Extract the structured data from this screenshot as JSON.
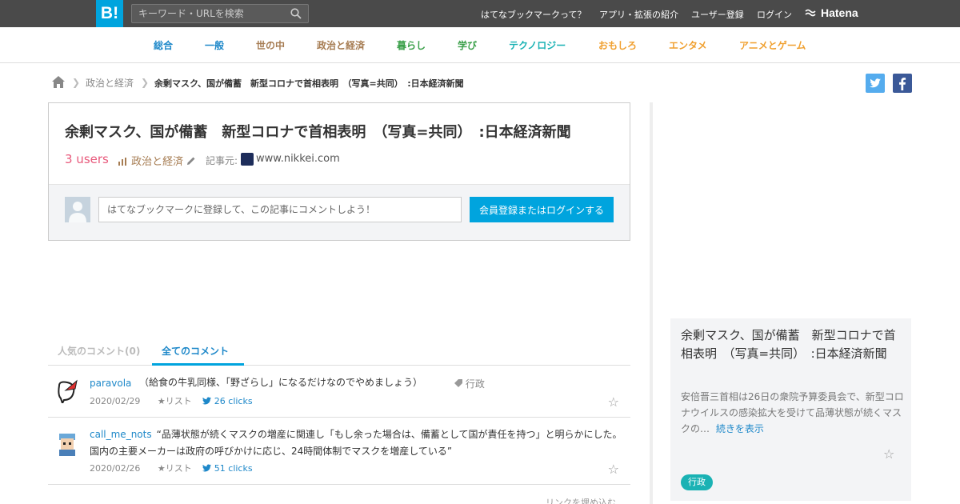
{
  "header": {
    "logo": "B!",
    "search_placeholder": "キーワード・URLを検索",
    "nav": [
      "はてなブックマークって？",
      "アプリ・拡張の紹介",
      "ユーザー登録",
      "ログイン"
    ],
    "brand": "Hatena"
  },
  "categories": [
    {
      "label": "総合",
      "color": "#1e88c9"
    },
    {
      "label": "一般",
      "color": "#1e88c9"
    },
    {
      "label": "世の中",
      "color": "#a67c52"
    },
    {
      "label": "政治と経済",
      "color": "#a67c52"
    },
    {
      "label": "暮らし",
      "color": "#3ba04a"
    },
    {
      "label": "学び",
      "color": "#3ba04a"
    },
    {
      "label": "テクノロジー",
      "color": "#1ab2b4"
    },
    {
      "label": "おもしろ",
      "color": "#f0a030"
    },
    {
      "label": "エンタメ",
      "color": "#f0a030"
    },
    {
      "label": "アニメとゲーム",
      "color": "#f0a030"
    }
  ],
  "breadcrumb": {
    "category": "政治と経済",
    "current": "余剰マスク、国が備蓄　新型コロナで首相表明　（写真=共同）　:日本経済新聞"
  },
  "entry": {
    "title": "余剰マスク、国が備蓄　新型コロナで首相表明　（写真=共同）　:日本経済新聞",
    "users": "3 users",
    "category": "政治と経済",
    "source_label": "記事元:",
    "source_domain": "www.nikkei.com",
    "comment_placeholder": "はてなブックマークに登録して、この記事にコメントしよう！",
    "login_button": "会員登録またはログインする"
  },
  "tabs": {
    "popular": "人気のコメント(0)",
    "all": "全てのコメント"
  },
  "comments": [
    {
      "user": "paravola",
      "text": "（給食の牛乳同様、「野ざらし」になるだけなのでやめましょう）",
      "tag": "行政",
      "date": "2020/02/29",
      "list": "リスト",
      "clicks": "26 clicks"
    },
    {
      "user": "call_me_nots",
      "text": "“品薄状態が続くマスクの増産に関連し「もし余った場合は、備蓄として国が責任を持つ」と明らかにした。国内の主要メーカーは政府の呼びかけに応じ、24時間体制でマスクを増産している”",
      "date": "2020/02/26",
      "list": "リスト",
      "clicks": "51 clicks"
    }
  ],
  "embed_link": "リンクを埋め込む",
  "card": {
    "title": "余剰マスク、国が備蓄　新型コロナで首相表明　（写真=共同）　:日本経済新聞",
    "description": "安倍晋三首相は26日の衆院予算委員会で、新型コロナウイルスの感染拡大を受けて品薄状態が続くマスクの…",
    "more": "続きを表示",
    "tag": "行政"
  },
  "colors": {
    "accent": "#00a4de",
    "users": "#e85a7c",
    "twitter": "#55acee",
    "facebook": "#3b5998"
  }
}
